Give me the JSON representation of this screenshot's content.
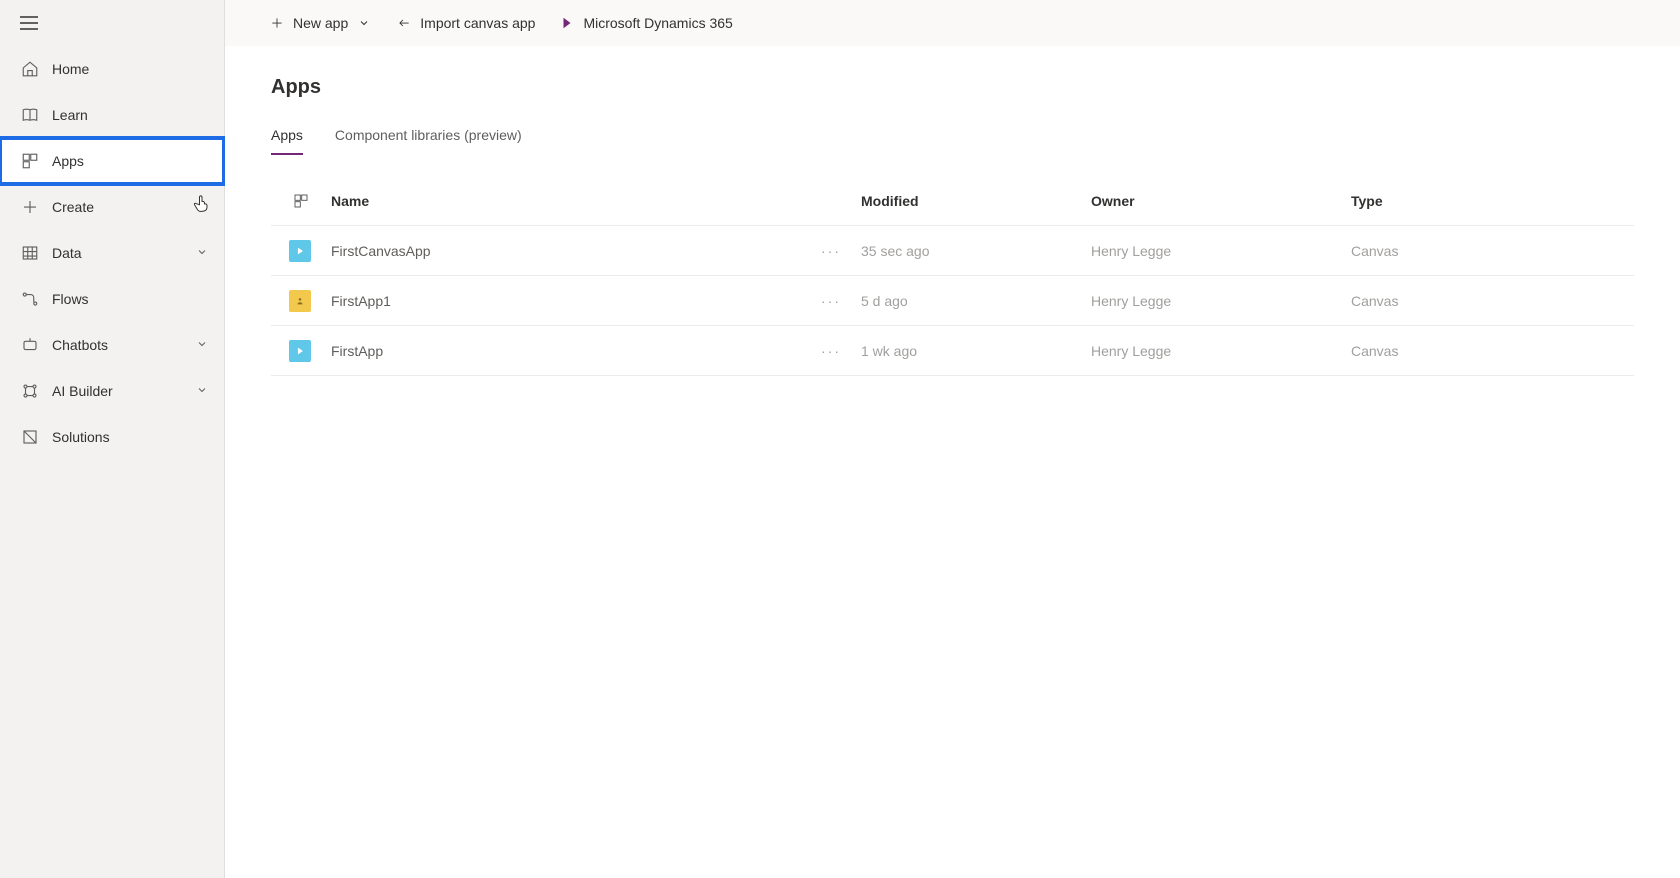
{
  "topbar": {
    "new_app": "New app",
    "import": "Import canvas app",
    "dynamics": "Microsoft Dynamics 365"
  },
  "sidebar": {
    "items": [
      {
        "label": "Home"
      },
      {
        "label": "Learn"
      },
      {
        "label": "Apps"
      },
      {
        "label": "Create"
      },
      {
        "label": "Data"
      },
      {
        "label": "Flows"
      },
      {
        "label": "Chatbots"
      },
      {
        "label": "AI Builder"
      },
      {
        "label": "Solutions"
      }
    ]
  },
  "main": {
    "title": "Apps",
    "tabs": [
      {
        "label": "Apps"
      },
      {
        "label": "Component libraries (preview)"
      }
    ],
    "columns": {
      "name": "Name",
      "modified": "Modified",
      "owner": "Owner",
      "type": "Type"
    },
    "rows": [
      {
        "name": "FirstCanvasApp",
        "modified": "35 sec ago",
        "owner": "Henry Legge",
        "type": "Canvas",
        "iconColor": "blue"
      },
      {
        "name": "FirstApp1",
        "modified": "5 d ago",
        "owner": "Henry Legge",
        "type": "Canvas",
        "iconColor": "yellow"
      },
      {
        "name": "FirstApp",
        "modified": "1 wk ago",
        "owner": "Henry Legge",
        "type": "Canvas",
        "iconColor": "blue"
      }
    ]
  }
}
